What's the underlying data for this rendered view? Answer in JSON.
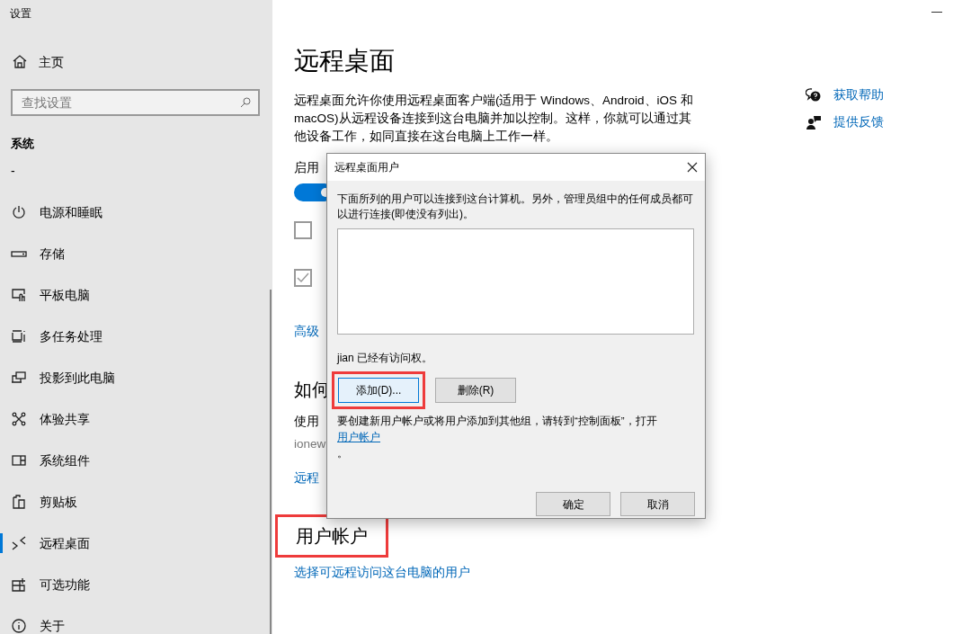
{
  "window": {
    "title": "设置"
  },
  "sidebar": {
    "home": "主页",
    "search": {
      "placeholder": "查找设置"
    },
    "section": "系统",
    "items": [
      {
        "label": "-",
        "selected": false
      },
      {
        "label": "电源和睡眠",
        "selected": false
      },
      {
        "label": "存储",
        "selected": false
      },
      {
        "label": "平板电脑",
        "selected": false
      },
      {
        "label": "多任务处理",
        "selected": false
      },
      {
        "label": "投影到此电脑",
        "selected": false
      },
      {
        "label": "体验共享",
        "selected": false
      },
      {
        "label": "系统组件",
        "selected": false
      },
      {
        "label": "剪贴板",
        "selected": false
      },
      {
        "label": "远程桌面",
        "selected": true
      },
      {
        "label": "可选功能",
        "selected": false
      },
      {
        "label": "关于",
        "selected": false
      }
    ]
  },
  "main": {
    "title": "远程桌面",
    "description": "远程桌面允许你使用远程桌面客户端(适用于 Windows、Android、iOS 和 macOS)从远程设备连接到这台电脑并加以控制。这样，你就可以通过其他设备工作，如同直接在这台电脑上工作一样。",
    "enable_label": "启用",
    "toggle": {
      "on": true
    },
    "checkboxes": [
      {
        "checked": false
      },
      {
        "checked": true
      }
    ],
    "advanced_link": "高级",
    "how_heading": "如何",
    "how_text": "使用",
    "pc_name": "ionew",
    "remote_link": "远程",
    "accounts_heading": {
      "text": "用户帐户",
      "highlighted": true
    },
    "accounts_link": "选择可远程访问这台电脑的用户"
  },
  "related_links": [
    {
      "label": "获取帮助"
    },
    {
      "label": "提供反馈"
    }
  ],
  "dialog": {
    "title": "远程桌面用户",
    "description": "下面所列的用户可以连接到这台计算机。另外，管理员组中的任何成员都可以进行连接(即使没有列出)。",
    "access_note": "jian 已经有访问权。",
    "buttons": [
      {
        "label": "添加(D)...",
        "focused": true,
        "highlighted": true
      },
      {
        "label": "删除(R)",
        "focused": false,
        "highlighted": false
      }
    ],
    "note": {
      "text": "要创建新用户帐户或将用户添加到其他组，请转到“控制面板”，打开",
      "link": "用户帐户",
      "tail": "。"
    },
    "footer_buttons": [
      "确定",
      "取消"
    ]
  }
}
